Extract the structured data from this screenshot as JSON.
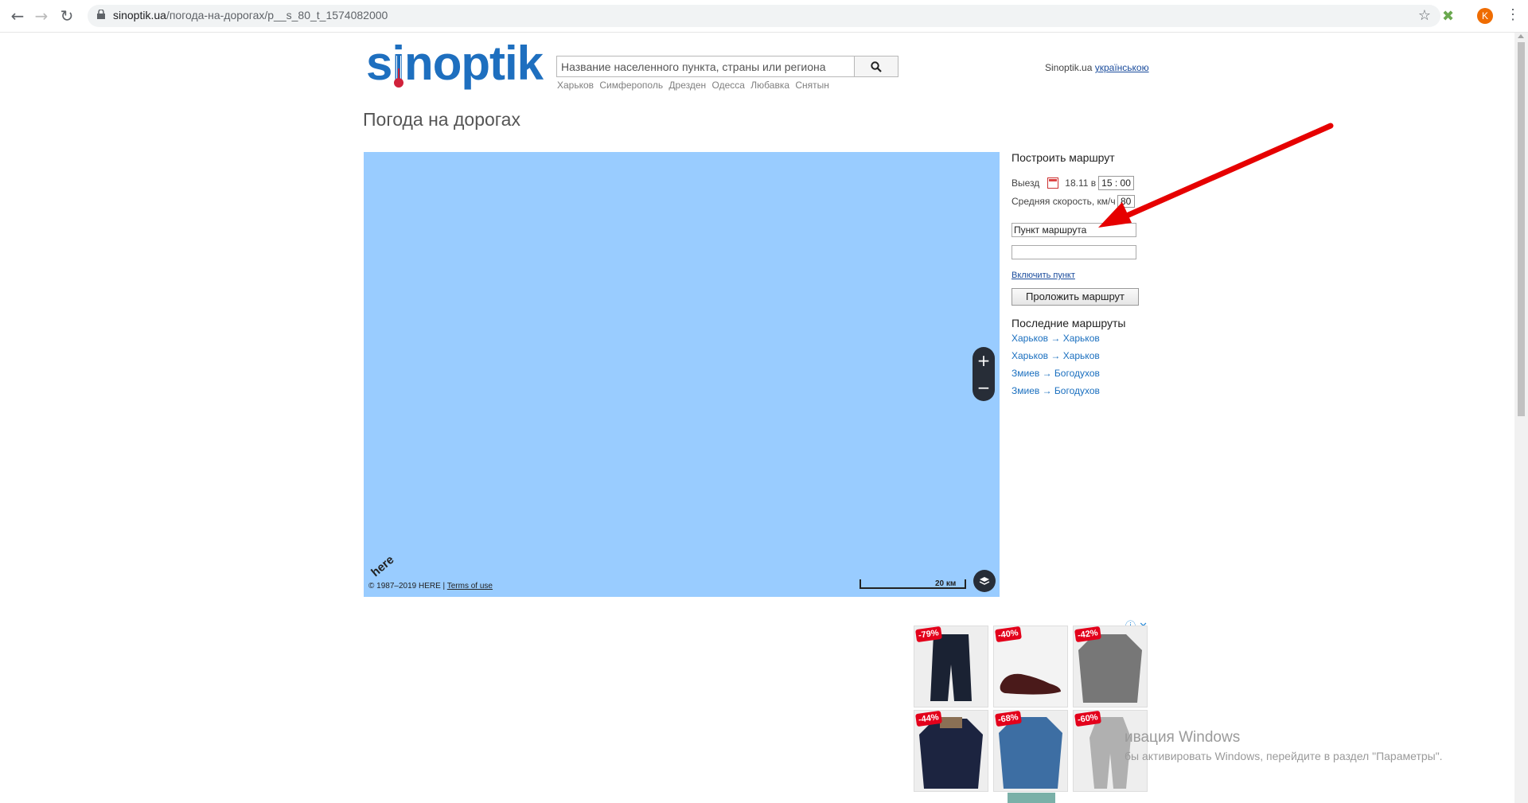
{
  "browser": {
    "url_host": "sinoptik.ua",
    "url_path": "/погода-на-дорогах/p__s_80_t_1574082000",
    "avatar_letter": "K"
  },
  "header": {
    "logo_text": "sinoptik",
    "search_placeholder": "Название населенного пункта, страны или региона",
    "quick_links": [
      "Харьков",
      "Симферополь",
      "Дрезден",
      "Одесса",
      "Любавка",
      "Снятын"
    ],
    "lang_label": "Sinoptik.ua",
    "lang_link": "українською"
  },
  "page": {
    "title": "Погода на дорогах"
  },
  "map": {
    "here_logo": "here",
    "copyright": "© 1987–2019 HERE |",
    "terms_link": "Terms of use",
    "scale_label": "20 км",
    "zoom_in": "+",
    "zoom_out": "−",
    "background_color": "#99ccff"
  },
  "route": {
    "title": "Построить маршрут",
    "departure_label": "Выезд",
    "departure_date": "18.11 в",
    "time_hours": "15",
    "time_minutes": "00",
    "speed_label": "Средняя скорость, км/ч",
    "speed_value": "80",
    "point1_value": "Пункт маршрута",
    "point2_value": "",
    "add_point_link": "Включить пункт",
    "build_button": "Проложить маршрут",
    "recent_title": "Последние маршруты",
    "recent_routes": [
      "Харьков → Харьков",
      "Харьков → Харьков",
      "Змиев → Богодухов",
      "Змиев → Богодухов"
    ]
  },
  "ad": {
    "discounts": [
      "-79%",
      "-40%",
      "-42%",
      "-44%",
      "-68%",
      "-60%"
    ]
  },
  "watermark": {
    "line1": "ивация Windows",
    "line2": "бы активировать Windows, перейдите в раздел \"Параметры\"."
  }
}
